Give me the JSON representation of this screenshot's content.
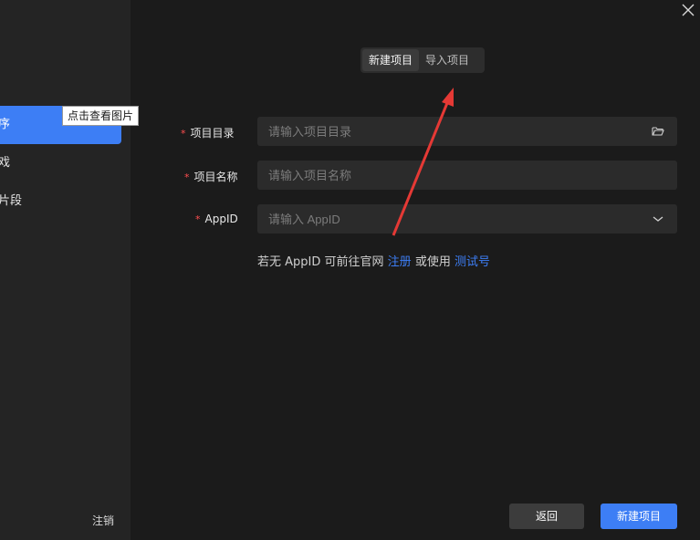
{
  "sidebar": {
    "items": [
      {
        "label": "序",
        "active": true
      },
      {
        "label": "戏",
        "active": false
      },
      {
        "label": "片段",
        "active": false
      }
    ],
    "tooltip": "点击查看图片",
    "logout": "注销"
  },
  "tabs": [
    {
      "label": "新建项目",
      "active": true
    },
    {
      "label": "导入项目",
      "active": false
    }
  ],
  "form": {
    "required_mark": "*",
    "dir": {
      "label": "项目目录",
      "placeholder": "请输入项目目录",
      "icon": "folder-open-icon"
    },
    "name": {
      "label": "项目名称",
      "placeholder": "请输入项目名称"
    },
    "appid": {
      "label": "AppID",
      "placeholder": "请输入 AppID",
      "icon": "chevron-down-icon"
    }
  },
  "hint": {
    "prefix": "若无 AppID 可前往官网",
    "register": "注册",
    "middle": "或使用",
    "test": "测试号"
  },
  "buttons": {
    "back": "返回",
    "create": "新建项目"
  },
  "colors": {
    "accent": "#3d7ef5",
    "required": "#ff4d4f",
    "annotation": "#e53935"
  }
}
